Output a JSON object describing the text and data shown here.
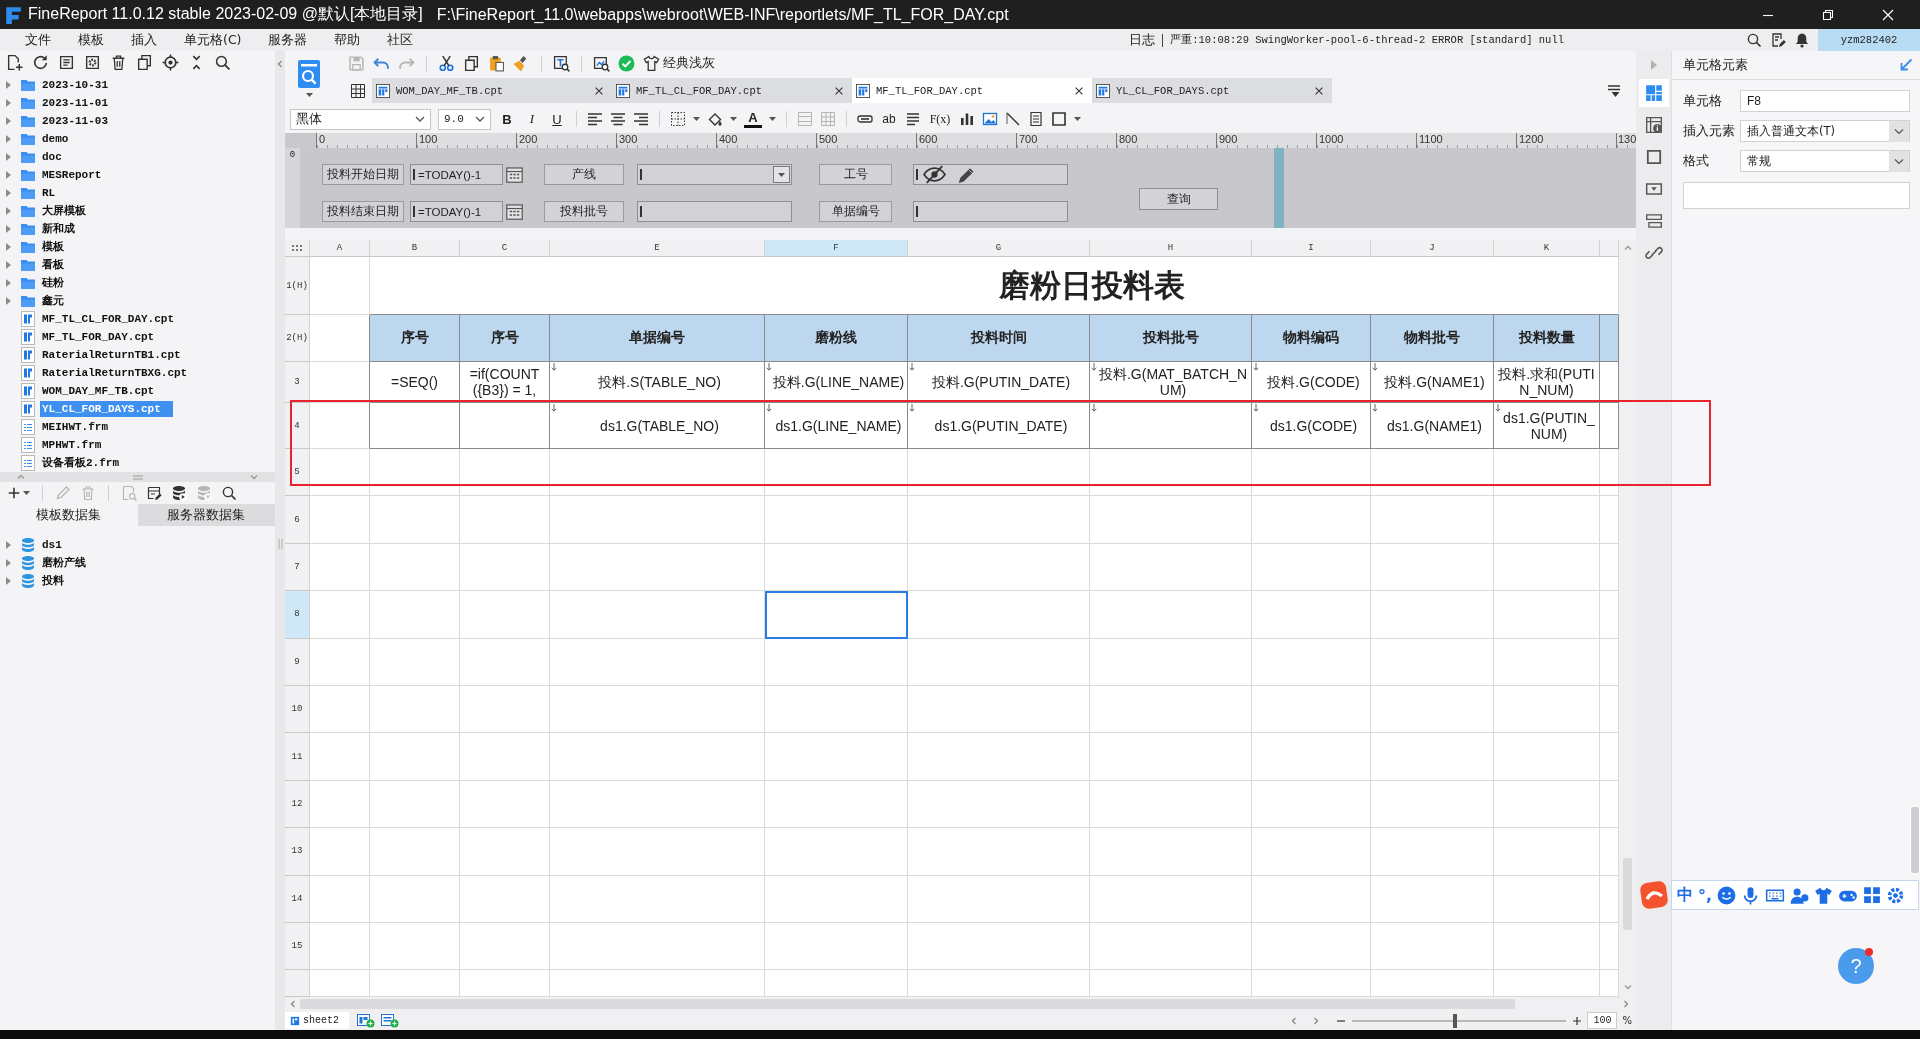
{
  "window": {
    "title": "FineReport 11.0.12 stable 2023-02-09 @默认[本地目录]",
    "path": "F:\\FineReport_11.0\\webapps\\webroot\\WEB-INF\\reportlets/MF_TL_FOR_DAY.cpt"
  },
  "menu": [
    "文件",
    "模板",
    "插入",
    "单元格(C)",
    "服务器",
    "帮助",
    "社区"
  ],
  "log": {
    "label": "日志",
    "message": "严重:10:08:29 SwingWorker-pool-6-thread-2 ERROR [standard] null"
  },
  "user": "yzm282402",
  "file_tree": [
    {
      "name": "2023-10-31",
      "kind": "folder",
      "selected": false
    },
    {
      "name": "2023-11-01",
      "kind": "folder",
      "selected": false
    },
    {
      "name": "2023-11-03",
      "kind": "folder",
      "selected": false
    },
    {
      "name": "demo",
      "kind": "folder",
      "selected": false
    },
    {
      "name": "doc",
      "kind": "folder",
      "selected": false
    },
    {
      "name": "MESReport",
      "kind": "folder",
      "selected": false
    },
    {
      "name": "RL",
      "kind": "folder",
      "selected": false
    },
    {
      "name": "大屏模板",
      "kind": "folder",
      "selected": false
    },
    {
      "name": "新和成",
      "kind": "folder",
      "selected": false
    },
    {
      "name": "模板",
      "kind": "folder",
      "selected": false
    },
    {
      "name": "看板",
      "kind": "folder",
      "selected": false
    },
    {
      "name": "硅粉",
      "kind": "folder",
      "selected": false
    },
    {
      "name": "鑫元",
      "kind": "folder",
      "selected": false
    },
    {
      "name": "MF_TL_CL_FOR_DAY.cpt",
      "kind": "cpt",
      "selected": false
    },
    {
      "name": "MF_TL_FOR_DAY.cpt",
      "kind": "cpt",
      "selected": false
    },
    {
      "name": "RaterialReturnTB1.cpt",
      "kind": "cpt",
      "selected": false
    },
    {
      "name": "RaterialReturnTBXG.cpt",
      "kind": "cpt",
      "selected": false
    },
    {
      "name": "WOM_DAY_MF_TB.cpt",
      "kind": "cpt",
      "selected": false
    },
    {
      "name": "YL_CL_FOR_DAYS.cpt",
      "kind": "cpt",
      "selected": true
    },
    {
      "name": "MEIHWT.frm",
      "kind": "frm",
      "selected": false
    },
    {
      "name": "MPHWT.frm",
      "kind": "frm",
      "selected": false
    },
    {
      "name": "设备看板2.frm",
      "kind": "frm",
      "selected": false
    }
  ],
  "dataset_tabs": [
    {
      "label": "模板数据集",
      "selected": true
    },
    {
      "label": "服务器数据集",
      "selected": false
    }
  ],
  "datasets": [
    "ds1",
    "磨粉产线",
    "投料"
  ],
  "toolbar": {
    "theme": "经典浅灰"
  },
  "tabs": [
    {
      "label": "WOM_DAY_MF_TB.cpt",
      "selected": false
    },
    {
      "label": "MF_TL_CL_FOR_DAY.cpt",
      "selected": false
    },
    {
      "label": "MF_TL_FOR_DAY.cpt",
      "selected": true
    },
    {
      "label": "YL_CL_FOR_DAYS.cpt",
      "selected": false
    }
  ],
  "format_bar": {
    "font": "黑体",
    "size": "9.0",
    "buttons": [
      "B",
      "I",
      "U",
      "A",
      "ab",
      "F(x)"
    ]
  },
  "ruler": [
    "0",
    "100",
    "200",
    "300",
    "400",
    "500",
    "600",
    "700",
    "800",
    "900",
    "1000",
    "1100",
    "1200",
    "130"
  ],
  "vruler": "0",
  "params": {
    "fields": [
      {
        "label": "投料开始日期",
        "kind": "date",
        "value": "=TODAY()-1",
        "hidden": false,
        "editing": false
      },
      {
        "label": "产线",
        "kind": "combo",
        "hidden": false,
        "editing": false
      },
      {
        "label": "工号",
        "kind": "text",
        "hidden": true,
        "editing": true
      },
      {
        "label": "投料结束日期",
        "kind": "date",
        "value": "=TODAY()-1",
        "hidden": false,
        "editing": false
      },
      {
        "label": "投料批号",
        "kind": "text",
        "hidden": false,
        "editing": false
      },
      {
        "label": "单据编号",
        "kind": "text",
        "hidden": false,
        "editing": false
      }
    ],
    "button": "查询"
  },
  "sheet": {
    "columns": [
      {
        "label": "A",
        "selected": false
      },
      {
        "label": "B",
        "selected": false
      },
      {
        "label": "C",
        "selected": false
      },
      {
        "label": "E",
        "selected": false
      },
      {
        "label": "F",
        "selected": true
      },
      {
        "label": "G",
        "selected": false
      },
      {
        "label": "H",
        "selected": false
      },
      {
        "label": "I",
        "selected": false
      },
      {
        "label": "J",
        "selected": false
      },
      {
        "label": "K",
        "selected": false
      }
    ],
    "rows": [
      {
        "label": "1(H)",
        "selected": false
      },
      {
        "label": "2(H)",
        "selected": false
      },
      {
        "label": "3",
        "selected": false
      },
      {
        "label": "4",
        "selected": false
      },
      {
        "label": "5",
        "selected": false
      },
      {
        "label": "6",
        "selected": false
      },
      {
        "label": "7",
        "selected": false
      },
      {
        "label": "8",
        "selected": true
      },
      {
        "label": "9",
        "selected": false
      },
      {
        "label": "10",
        "selected": false
      },
      {
        "label": "11",
        "selected": false
      },
      {
        "label": "12",
        "selected": false
      },
      {
        "label": "13",
        "selected": false
      },
      {
        "label": "14",
        "selected": false
      },
      {
        "label": "15",
        "selected": false
      }
    ],
    "title": "磨粉日投料表",
    "headers": [
      "序号",
      "序号",
      "单据编号",
      "磨粉线",
      "投料时间",
      "投料批号",
      "物料编码",
      "物料批号",
      "投料数量"
    ],
    "data_rows": [
      [
        {
          "text": "=SEQ()",
          "expand": false
        },
        {
          "text": "=if(COUNT({B3}) = 1,",
          "expand": false
        },
        {
          "text": "投料.S(TABLE_NO)",
          "expand": true
        },
        {
          "text": "投料.G(LINE_NAME)",
          "expand": true
        },
        {
          "text": "投料.G(PUTIN_DATE)",
          "expand": true
        },
        {
          "text": "投料.G(MAT_BATCH_NUM)",
          "expand": true
        },
        {
          "text": "投料.G(CODE)",
          "expand": true
        },
        {
          "text": "投料.G(NAME1)",
          "expand": true
        },
        {
          "text": "投料.求和(PUTIN_NUM)",
          "expand": false
        }
      ],
      [
        {
          "expand": false
        },
        {
          "expand": false
        },
        {
          "text": "ds1.G(TABLE_NO)",
          "expand": true
        },
        {
          "text": "ds1.G(LINE_NAME)",
          "expand": true
        },
        {
          "text": "ds1.G(PUTIN_DATE)",
          "expand": true
        },
        {
          "expand": true
        },
        {
          "text": "ds1.G(CODE)",
          "expand": true
        },
        {
          "text": "ds1.G(NAME1)",
          "expand": true
        },
        {
          "text": "ds1.G(PUTIN_NUM)",
          "expand": true
        }
      ]
    ]
  },
  "cell_panel": {
    "title": "单元格元素",
    "fields": [
      {
        "label": "单元格",
        "kind": "text",
        "value": "F8"
      },
      {
        "label": "插入元素",
        "kind": "select",
        "value": "插入普通文本(T)"
      },
      {
        "label": "格式",
        "kind": "select",
        "value": "常规"
      }
    ]
  },
  "sheet_tabs": [
    {
      "label": "sheet2",
      "selected": true
    }
  ],
  "zoom": {
    "level": 0.48,
    "value": "100",
    "unit": "%"
  },
  "ime": {
    "mode": "中",
    "punct": "°,"
  },
  "help": "?",
  "annotation": {
    "kind": "rectangle"
  }
}
